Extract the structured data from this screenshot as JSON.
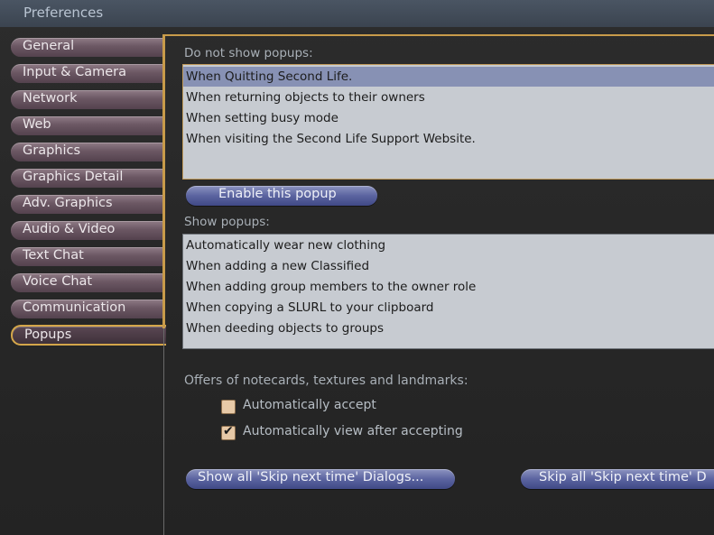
{
  "window": {
    "title": "Preferences"
  },
  "sidebar": {
    "tabs": [
      {
        "label": "General"
      },
      {
        "label": "Input & Camera"
      },
      {
        "label": "Network"
      },
      {
        "label": "Web"
      },
      {
        "label": "Graphics"
      },
      {
        "label": "Graphics Detail"
      },
      {
        "label": "Adv. Graphics"
      },
      {
        "label": "Audio & Video"
      },
      {
        "label": "Text Chat"
      },
      {
        "label": "Voice Chat"
      },
      {
        "label": "Communication"
      },
      {
        "label": "Popups"
      }
    ],
    "selected": "Popups"
  },
  "popups": {
    "hidden_label": "Do not show popups:",
    "hidden_items": [
      "When Quitting Second Life.",
      "When returning objects to their owners",
      "When setting busy mode",
      "When visiting the Second Life Support Website."
    ],
    "hidden_selected": "When Quitting Second Life.",
    "enable_button": "Enable this popup",
    "shown_label": "Show popups:",
    "shown_items": [
      "Automatically wear new clothing",
      "When adding a new Classified",
      "When adding group members to the owner role",
      "When copying a SLURL to your clipboard",
      "When deeding objects to groups"
    ],
    "offers_label": "Offers of notecards, textures and landmarks:",
    "auto_accept": {
      "label": "Automatically accept",
      "checked": false
    },
    "auto_view": {
      "label": "Automatically view after accepting",
      "checked": true
    },
    "show_all_button": "Show all 'Skip next time' Dialogs...",
    "skip_all_button": "Skip all 'Skip next time' D"
  },
  "colors": {
    "tab": "#6b5763",
    "tab_selected_border": "#d4a64a",
    "button": "#5b64a0",
    "list_bg": "#c7cbd1",
    "list_selected": "#8791b4",
    "label_text": "#a9b0b7"
  }
}
